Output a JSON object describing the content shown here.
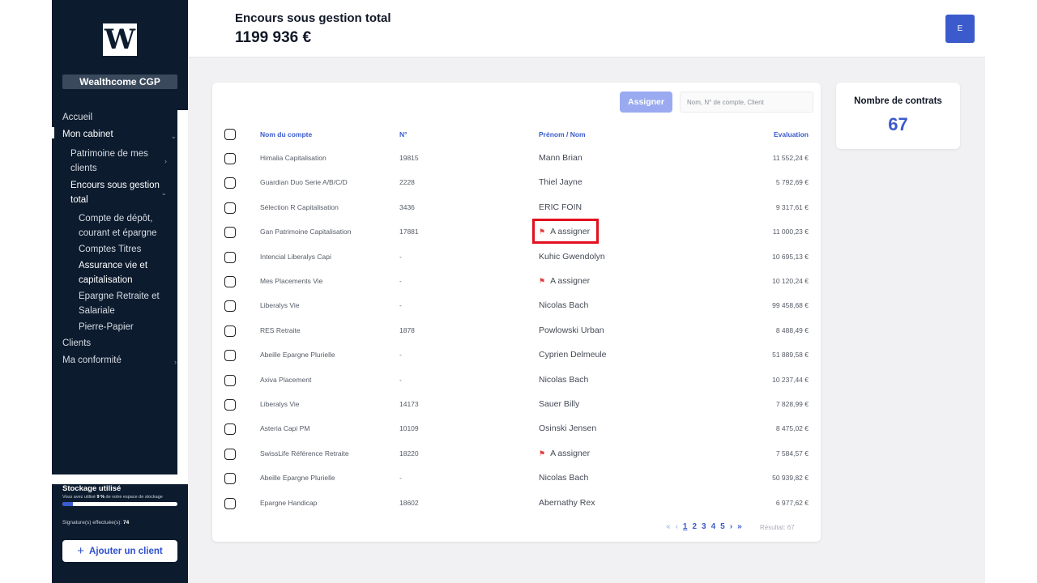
{
  "sidebar": {
    "logo_letter": "W",
    "org_name": "Wealthcome CGP",
    "nav": [
      {
        "label": "Accueil"
      },
      {
        "label": "Mon cabinet"
      },
      {
        "label": "Patrimoine de mes clients"
      },
      {
        "label": "Encours sous gestion total"
      },
      {
        "label": "Compte de dépôt, courant et épargne"
      },
      {
        "label": "Comptes Titres"
      },
      {
        "label": "Assurance vie et capitalisation"
      },
      {
        "label": "Epargne Retraite et Salariale"
      },
      {
        "label": "Pierre-Papier"
      },
      {
        "label": "Clients"
      },
      {
        "label": "Ma conformité"
      }
    ],
    "storage": {
      "title": "Stockage utilisé",
      "desc_prefix": "Vous avez utilisé",
      "percent": "9 %",
      "desc_suffix": "de votre espace de stockage",
      "used_fraction": 0.09
    },
    "signatures_label": "Signature(s) effectuée(s):",
    "signatures_count": "74",
    "add_client_label": "Ajouter un client",
    "add_client_icon": "plus-icon"
  },
  "header": {
    "title": "Encours sous gestion total",
    "amount": "1199 936 €",
    "avatar_letter": "E"
  },
  "table": {
    "assign_button": "Assigner",
    "search_placeholder": "Nom, N° de compte, Client",
    "columns": {
      "name": "Nom du compte",
      "number": "N°",
      "client": "Prénom / Nom",
      "evaluation": "Evaluation"
    },
    "rows": [
      {
        "name": "Himalia Capitalisation",
        "number": "19815",
        "client": "Mann Brian",
        "flag": false,
        "evaluation": "11 552,24 €"
      },
      {
        "name": "Guardian Duo Serie A/B/C/D",
        "number": "2228",
        "client": "Thiel Jayne",
        "flag": false,
        "evaluation": "5 792,69 €"
      },
      {
        "name": "Sélection R Capitalisation",
        "number": "3436",
        "client": "ERIC FOIN",
        "flag": false,
        "evaluation": "9 317,61 €"
      },
      {
        "name": "Gan Patrimoine Capitalisation",
        "number": "17881",
        "client": "A assigner",
        "flag": true,
        "evaluation": "11 000,23 €"
      },
      {
        "name": "Intencial Liberalys Capi",
        "number": "-",
        "client": "Kuhic Gwendolyn",
        "flag": false,
        "evaluation": "10 695,13 €"
      },
      {
        "name": "Mes Placements Vie",
        "number": "-",
        "client": "A assigner",
        "flag": true,
        "evaluation": "10 120,24 €"
      },
      {
        "name": "Liberalys Vie",
        "number": "-",
        "client": "Nicolas Bach",
        "flag": false,
        "evaluation": "99 458,68 €"
      },
      {
        "name": "RES Retraite",
        "number": "1878",
        "client": "Powlowski Urban",
        "flag": false,
        "evaluation": "8 488,49 €"
      },
      {
        "name": "Abeille Epargne Plurielle",
        "number": "-",
        "client": "Cyprien Delmeule",
        "flag": false,
        "evaluation": "51 889,58 €"
      },
      {
        "name": "Axiva Placement",
        "number": "-",
        "client": "Nicolas Bach",
        "flag": false,
        "evaluation": "10 237,44 €"
      },
      {
        "name": "Liberalys Vie",
        "number": "14173",
        "client": "Sauer Billy",
        "flag": false,
        "evaluation": "7 828,99 €"
      },
      {
        "name": "Asteria Capi PM",
        "number": "10109",
        "client": "Osinski Jensen",
        "flag": false,
        "evaluation": "8 475,02 €"
      },
      {
        "name": "SwissLife Référence Retraite",
        "number": "18220",
        "client": "A assigner",
        "flag": true,
        "evaluation": "7 584,57 €"
      },
      {
        "name": "Abeille Epargne Plurielle",
        "number": "-",
        "client": "Nicolas Bach",
        "flag": false,
        "evaluation": "50 939,82 €"
      },
      {
        "name": "Epargne Handicap",
        "number": "18602",
        "client": "Abernathy Rex",
        "flag": false,
        "evaluation": "6 977,62 €"
      }
    ],
    "pagination": {
      "first": "«",
      "prev": "‹",
      "pages": [
        "1",
        "2",
        "3",
        "4",
        "5"
      ],
      "current": "1",
      "next": "›",
      "last": "»"
    },
    "result_text": "Résultat: 67"
  },
  "stats": {
    "contracts_label": "Nombre de contrats",
    "contracts_value": "67"
  },
  "colors": {
    "sidebar_bg": "#0c1b2e",
    "accent": "#3b5bcc",
    "highlight": "#e10f1f",
    "flag": "#e23b3b"
  }
}
